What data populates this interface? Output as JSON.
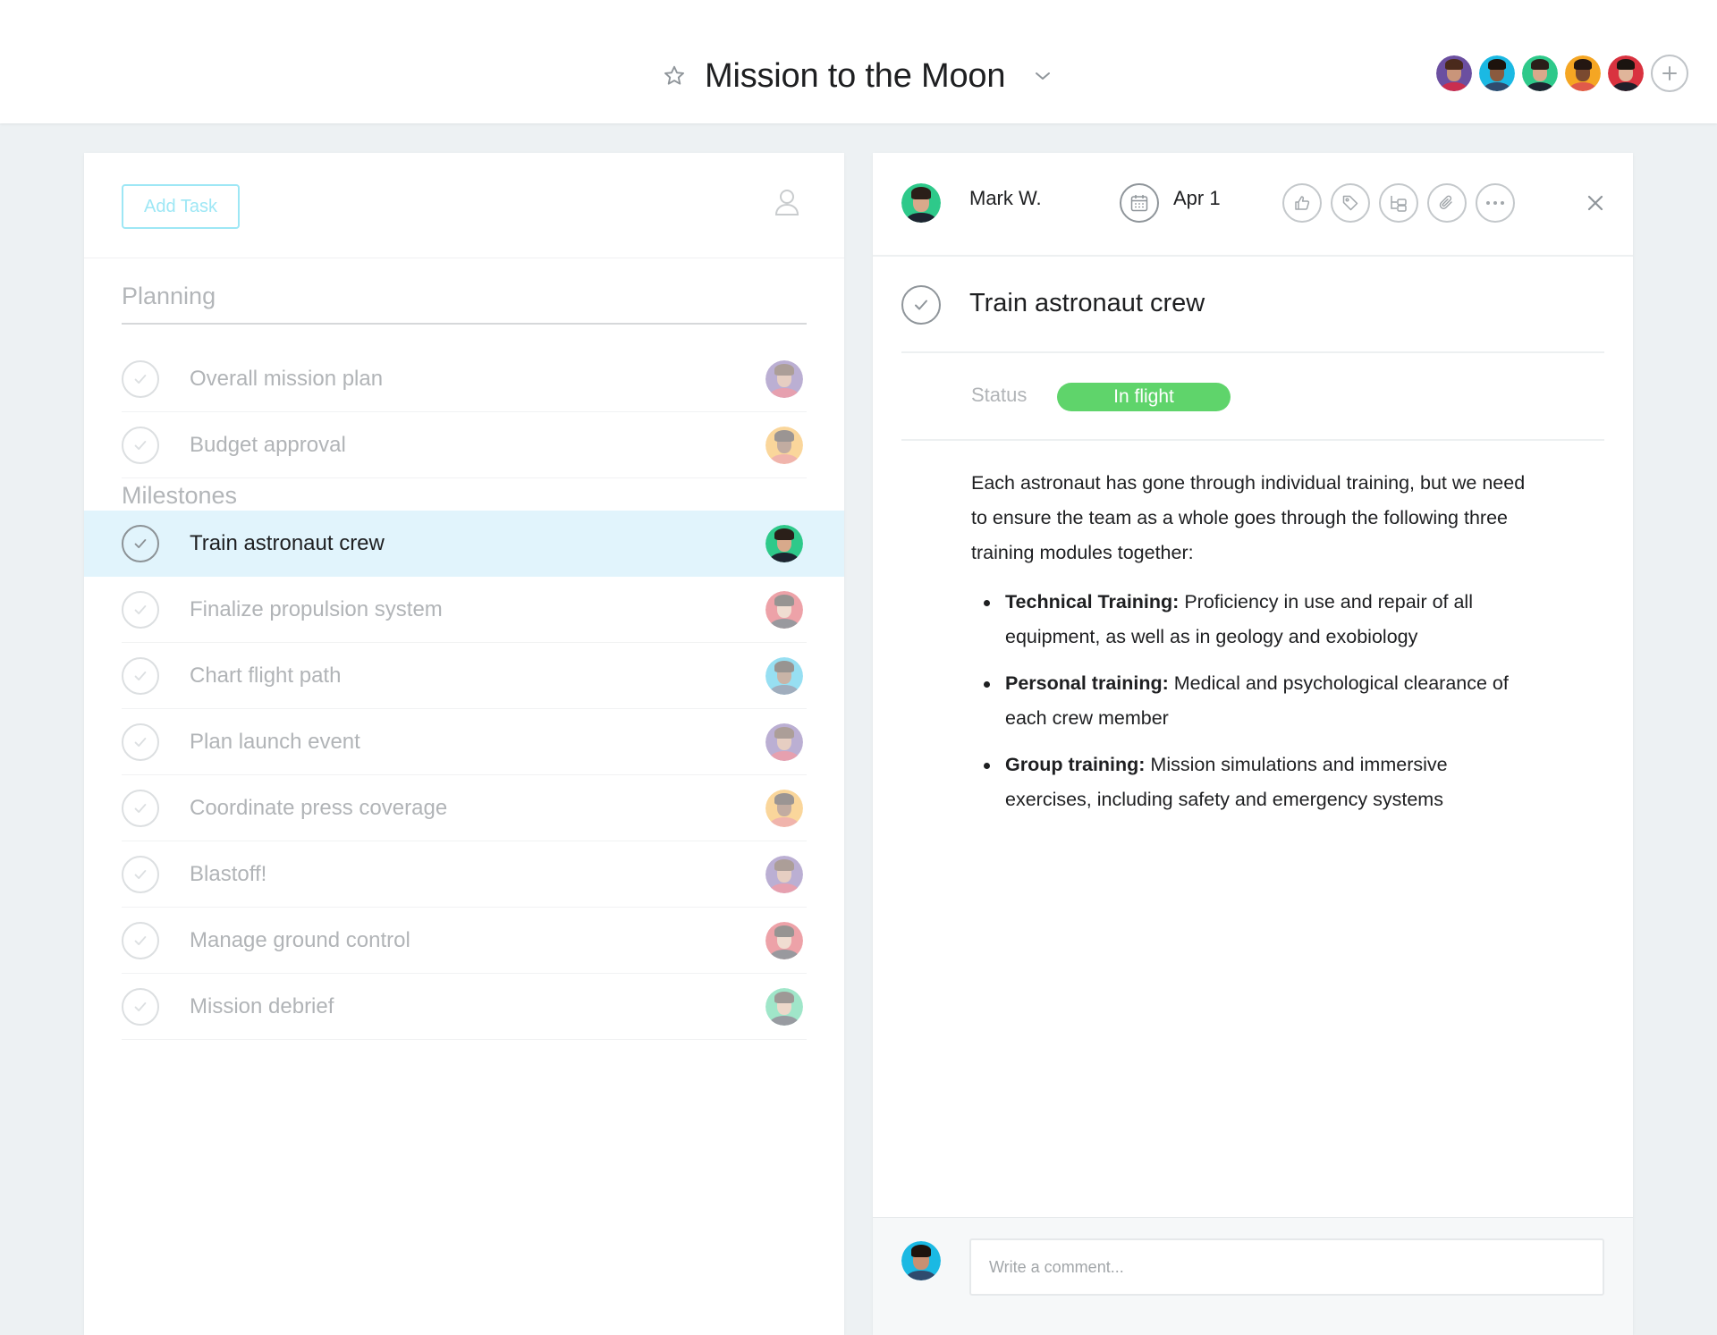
{
  "header": {
    "project_title": "Mission to the Moon",
    "star_icon": "star-icon",
    "chevron_icon": "chevron-down-icon",
    "members": [
      {
        "name": "member-1",
        "bg": "#6b4fa0",
        "skin": "#c9957a",
        "hair": "#4a2a1c",
        "shirt": "#c92e4f"
      },
      {
        "name": "member-2",
        "bg": "#1bb9e3",
        "skin": "#8a5a3e",
        "hair": "#1d130d",
        "shirt": "#2f4b6e"
      },
      {
        "name": "member-3",
        "bg": "#2ec98a",
        "skin": "#d8a98b",
        "hair": "#2a1f19",
        "shirt": "#1d2430"
      },
      {
        "name": "member-4",
        "bg": "#f5a623",
        "skin": "#7a4a30",
        "hair": "#241712",
        "shirt": "#e05a4a"
      },
      {
        "name": "member-5",
        "bg": "#d9323f",
        "skin": "#e0b59a",
        "hair": "#1b1410",
        "shirt": "#1f1f2a"
      }
    ],
    "add_member_icon": "plus-icon"
  },
  "task_list": {
    "add_task_label": "Add Task",
    "sections": [
      {
        "title": "Planning"
      },
      {
        "title": "Milestones"
      }
    ],
    "tasks": [
      {
        "name": "Overall mission plan",
        "avatar": "member-1",
        "selected": false
      },
      {
        "name": "Budget approval",
        "avatar": "member-4",
        "selected": false
      },
      {
        "name": "Train astronaut crew",
        "avatar": "member-3",
        "selected": true
      },
      {
        "name": "Finalize propulsion system",
        "avatar": "member-5",
        "selected": false
      },
      {
        "name": "Chart flight path",
        "avatar": "member-2",
        "selected": false
      },
      {
        "name": "Plan launch event",
        "avatar": "member-1",
        "selected": false
      },
      {
        "name": "Coordinate press coverage",
        "avatar": "member-4",
        "selected": false
      },
      {
        "name": "Blastoff!",
        "avatar": "member-1",
        "selected": false
      },
      {
        "name": "Manage ground control",
        "avatar": "member-5",
        "selected": false
      },
      {
        "name": "Mission debrief",
        "avatar": "member-3",
        "selected": false
      }
    ]
  },
  "detail": {
    "assignee": "Mark W.",
    "due_date": "Apr 1",
    "toolbar_icons": [
      "thumbs-up-icon",
      "tag-icon",
      "subtask-icon",
      "attachment-icon",
      "more-icon"
    ],
    "close_icon": "close-icon",
    "title": "Train astronaut crew",
    "status_label": "Status",
    "status_value": "In flight",
    "status_color": "#5fd46b",
    "description_intro": "Each astronaut has gone through individual training, but we need to ensure the team as a whole goes through the following three training modules together:",
    "bullets": [
      {
        "bold": "Technical Training:",
        "text": " Proficiency in use and repair of all equipment, as well as in geology and exobiology"
      },
      {
        "bold": "Personal training:",
        "text": " Medical and psychological clearance of each crew member"
      },
      {
        "bold": "Group training:",
        "text": " Mission simulations and immersive exercises, including safety and emergency systems"
      }
    ],
    "comment_placeholder": "Write a comment..."
  },
  "colors": {
    "accent": "#14aaf5",
    "add_task_border": "#9ee7f5",
    "selected_row": "#e1f4fc",
    "background": "#edf1f3"
  }
}
